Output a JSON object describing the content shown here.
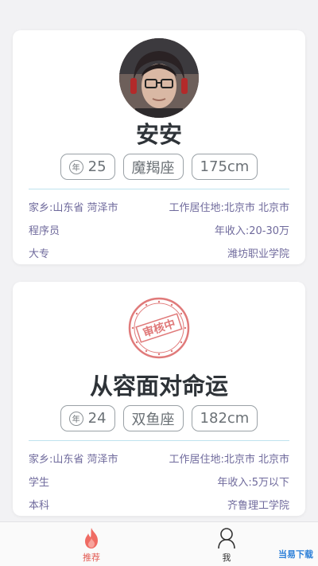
{
  "profiles": [
    {
      "name": "安安",
      "age": "25",
      "age_icon": "年",
      "zodiac": "魔羯座",
      "height": "175cm",
      "hometown": "家乡:山东省 菏泽市",
      "work_city": "工作居住地:北京市 北京市",
      "occupation": "程序员",
      "income": "年收入:20-30万",
      "education": "大专",
      "school": "潍坊职业学院"
    },
    {
      "name": "从容面对命运",
      "seal_text": "审核中",
      "age": "24",
      "age_icon": "年",
      "zodiac": "双鱼座",
      "height": "182cm",
      "hometown": "家乡:山东省 菏泽市",
      "work_city": "工作居住地:北京市 北京市",
      "occupation": "学生",
      "income": "年收入:5万以下",
      "education": "本科",
      "school": "齐鲁理工学院"
    }
  ],
  "tabbar": {
    "home_label": "推荐",
    "me_label": "我",
    "active_color": "#e25a52"
  },
  "watermark": "当易下载"
}
